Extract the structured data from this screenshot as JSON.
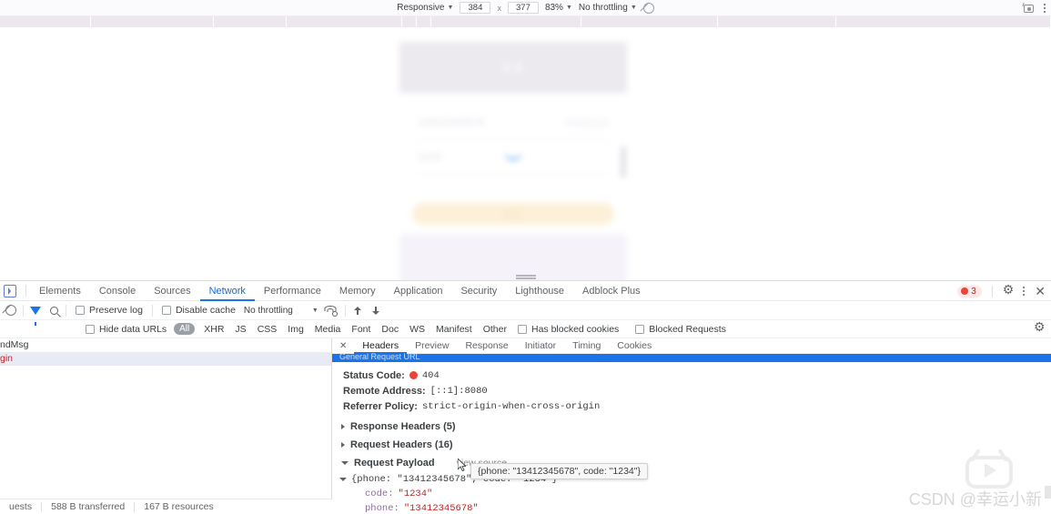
{
  "device_toolbar": {
    "device_label": "Responsive",
    "width": "384",
    "height": "377",
    "separator": "x",
    "zoom": "83%",
    "throttling": "No throttling",
    "no_throttle_icon": "no-throttle-icon",
    "screenshot_icon": "camera-icon",
    "more_icon": "kebab-menu-icon"
  },
  "preview": {
    "header_title": "登录",
    "phone_value": "13412345678",
    "get_code_label": "获取验证码",
    "code_value": "1234",
    "submit_label": "登录",
    "spinner": "loading-spinner"
  },
  "devtools": {
    "inspect_icon": "inspect-element-icon",
    "tabs": [
      {
        "label": "Elements",
        "active": false
      },
      {
        "label": "Console",
        "active": false
      },
      {
        "label": "Sources",
        "active": false
      },
      {
        "label": "Network",
        "active": true
      },
      {
        "label": "Performance",
        "active": false
      },
      {
        "label": "Memory",
        "active": false
      },
      {
        "label": "Application",
        "active": false
      },
      {
        "label": "Security",
        "active": false
      },
      {
        "label": "Lighthouse",
        "active": false
      },
      {
        "label": "Adblock Plus",
        "active": false
      }
    ],
    "error_count": "3",
    "settings_icon": "gear-icon",
    "more_icon": "kebab-menu-icon",
    "close_icon": "close-icon",
    "accent_color": "#1a73e8",
    "error_color": "#e8443a"
  },
  "network_toolbar": {
    "clear_icon": "clear-requests-icon",
    "filter_icon": "filter-funnel-icon",
    "search_icon": "search-icon",
    "preserve_log_label": "Preserve log",
    "disable_cache_label": "Disable cache",
    "throttling_label": "No throttling",
    "network_conditions_icon": "network-conditions-icon",
    "import_icon": "import-har-icon",
    "export_icon": "export-har-icon"
  },
  "filter_row": {
    "hide_data_urls_label": "Hide data URLs",
    "types": [
      "All",
      "XHR",
      "JS",
      "CSS",
      "Img",
      "Media",
      "Font",
      "Doc",
      "WS",
      "Manifest",
      "Other"
    ],
    "has_blocked_cookies_label": "Has blocked cookies",
    "blocked_requests_label": "Blocked Requests",
    "settings_icon": "gear-icon"
  },
  "request_list": {
    "rows": [
      {
        "name": "ndMsg",
        "selected": false
      },
      {
        "name": "gin",
        "selected": true
      }
    ]
  },
  "detail_panel": {
    "close_icon": "close-panel-icon",
    "tabs": [
      {
        "label": "Headers",
        "active": true
      },
      {
        "label": "Preview",
        "active": false
      },
      {
        "label": "Response",
        "active": false
      },
      {
        "label": "Initiator",
        "active": false
      },
      {
        "label": "Timing",
        "active": false
      },
      {
        "label": "Cookies",
        "active": false
      }
    ],
    "highlighted_row_text": "General Request URL",
    "general": [
      {
        "key": "Status Code:",
        "value": "404",
        "has_error_dot": true
      },
      {
        "key": "Remote Address:",
        "value": "[::1]:8080",
        "has_error_dot": false
      },
      {
        "key": "Referrer Policy:",
        "value": "strict-origin-when-cross-origin",
        "has_error_dot": false
      }
    ],
    "sections": [
      {
        "title": "Response Headers (5)",
        "expanded": false,
        "action": ""
      },
      {
        "title": "Request Headers (16)",
        "expanded": false,
        "action": ""
      },
      {
        "title": "Request Payload",
        "expanded": true,
        "action": "view source"
      }
    ],
    "payload": {
      "summary": "{phone: \"13412345678\", code: \"1234\"}",
      "entries": [
        {
          "key": "code:",
          "value": "\"1234\""
        },
        {
          "key": "phone:",
          "value": "\"13412345678\""
        }
      ]
    },
    "tooltip": "{phone: \"13412345678\", code: \"1234\"}"
  },
  "status_bar": {
    "requests": "uests",
    "transferred": "588 B transferred",
    "resources": "167 B resources"
  },
  "watermark": {
    "text": "CSDN @幸运小新",
    "logo_icon": "csdn-tv-play-icon"
  }
}
